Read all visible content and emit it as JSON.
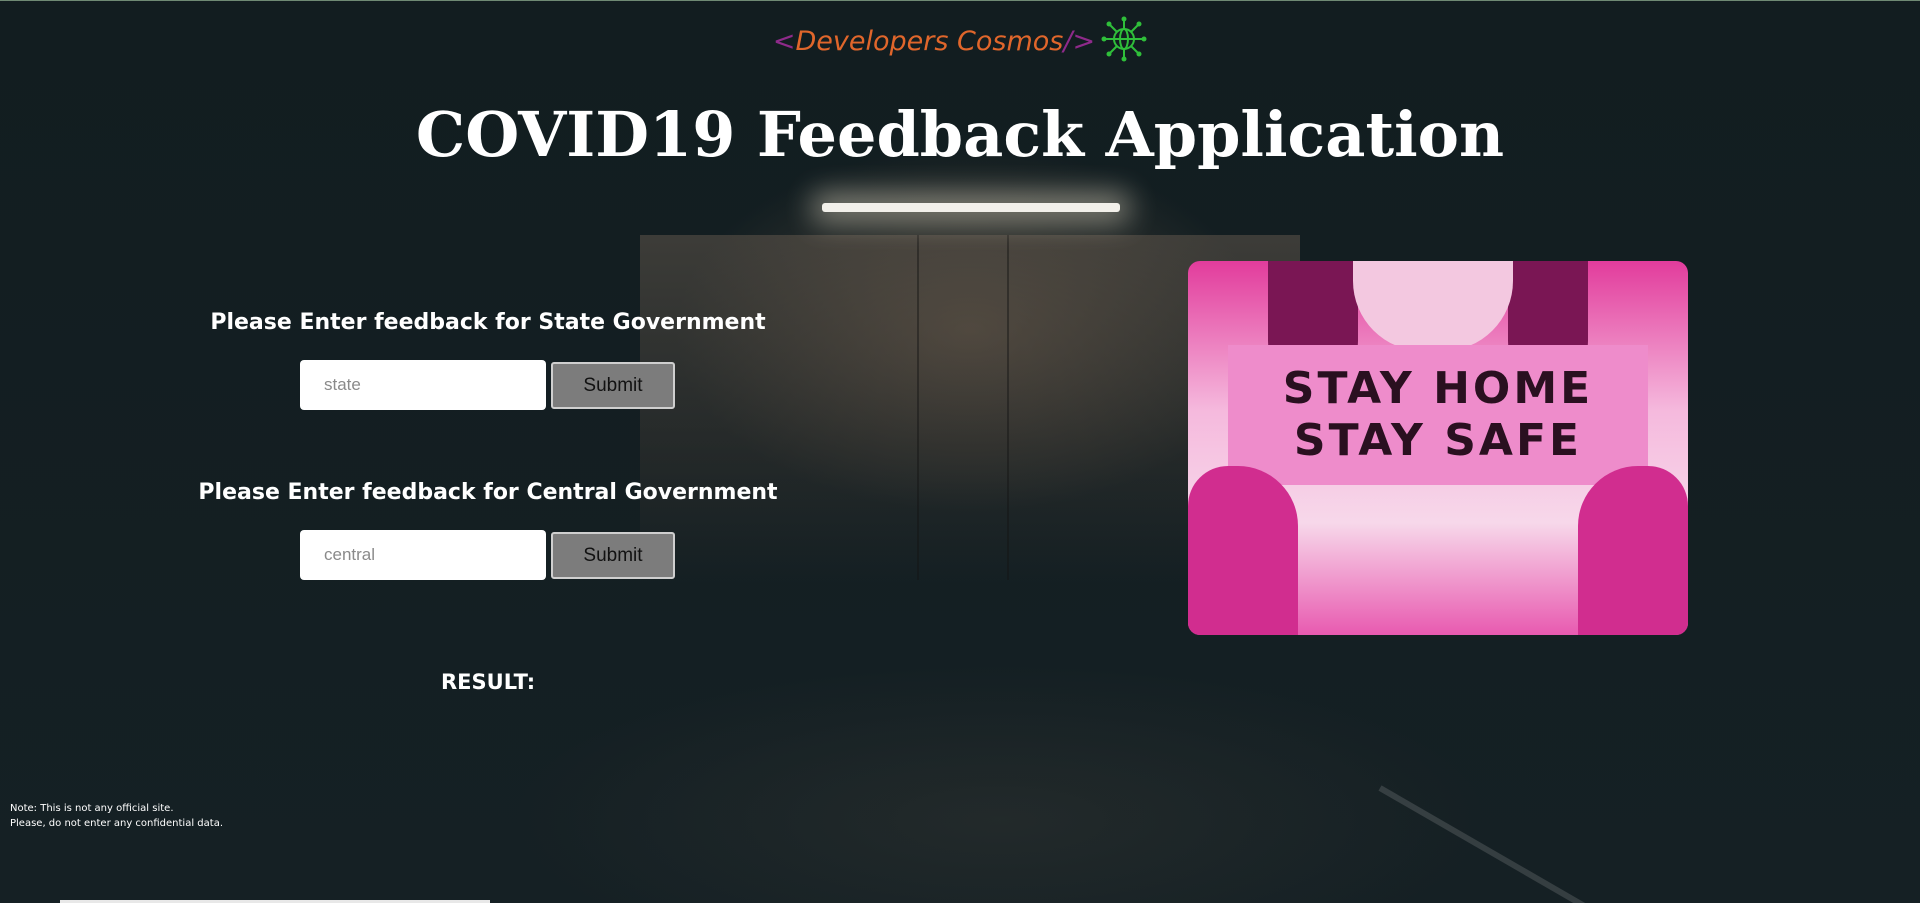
{
  "brand": {
    "open_bracket": "<",
    "name": "Developers Cosmos",
    "close_bracket": "/>",
    "icon": "globe-network-icon",
    "colors": {
      "bracket": "#8e2a8a",
      "name": "#e0662b",
      "icon": "#2fbf3a"
    }
  },
  "title": "COVID19 Feedback Application",
  "state_form": {
    "label": "Please Enter feedback for State Government",
    "placeholder": "state",
    "value": "",
    "submit_label": "Submit"
  },
  "central_form": {
    "label": "Please Enter feedback for Central Government",
    "placeholder": "central",
    "value": "",
    "submit_label": "Submit"
  },
  "result": {
    "label": "RESULT:",
    "value": ""
  },
  "note": {
    "line1": "Note: This is not any official site.",
    "line2": "Please, do not enter any confidential data."
  },
  "poster": {
    "line1": "STAY HOME",
    "line2": "STAY SAFE"
  }
}
